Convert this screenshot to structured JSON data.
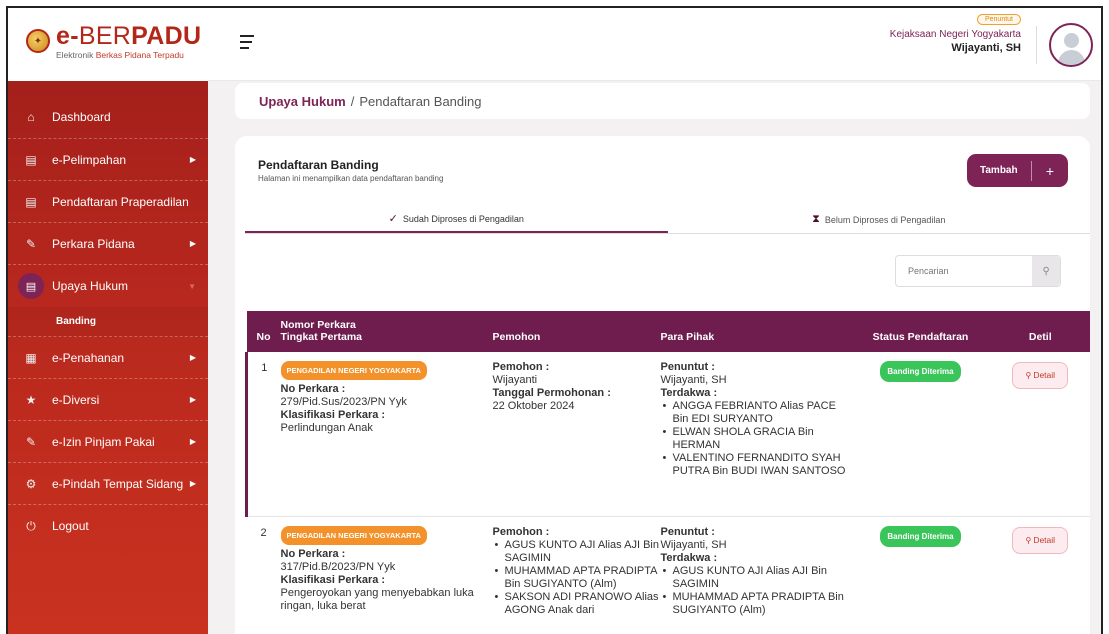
{
  "brand": {
    "title_e": "e-",
    "title_ber": "BER",
    "title_padu": "PADU",
    "sub_a": "Elektronik ",
    "sub_b": "Berkas Pidana Terpadu"
  },
  "user": {
    "role": "Penuntut",
    "org": "Kejaksaan Negeri Yogyakarta",
    "name": "Wijayanti, SH"
  },
  "sidebar": {
    "items": [
      {
        "label": "Dashboard",
        "icon": "home-icon"
      },
      {
        "label": "e-Pelimpahan",
        "icon": "document-icon"
      },
      {
        "label": "Pendaftaran Praperadilan",
        "icon": "document-icon"
      },
      {
        "label": "Perkara Pidana",
        "icon": "edit-icon"
      },
      {
        "label": "Upaya Hukum",
        "icon": "document-icon"
      },
      {
        "label": "e-Penahanan",
        "icon": "grid-icon"
      },
      {
        "label": "e-Diversi",
        "icon": "star-icon"
      },
      {
        "label": "e-Izin Pinjam Pakai",
        "icon": "edit-icon"
      },
      {
        "label": "e-Pindah Tempat Sidang",
        "icon": "gear-icon"
      },
      {
        "label": "Logout",
        "icon": "power-icon"
      }
    ],
    "sub_items": [
      {
        "label": "Banding"
      }
    ]
  },
  "breadcrumb": {
    "root": "Upaya Hukum",
    "sep": "/",
    "current": "Pendaftaran Banding"
  },
  "card": {
    "title": "Pendaftaran Banding",
    "subtitle": "Halaman ini menampilkan data pendaftaran banding",
    "add_label": "Tambah",
    "add_plus": "+"
  },
  "tabs": [
    {
      "label": "Sudah Diproses di Pengadilan",
      "icon": "check-icon"
    },
    {
      "label": "Belum Diproses di Pengadilan",
      "icon": "hourglass-icon"
    }
  ],
  "search": {
    "placeholder": "Pencarian"
  },
  "table": {
    "headers": {
      "no": "No",
      "nomor_a": "Nomor Perkara",
      "nomor_b": "Tingkat Pertama",
      "pemohon": "Pemohon",
      "pihak": "Para Pihak",
      "status": "Status Pendaftaran",
      "detil": "Detil"
    },
    "rows": [
      {
        "no": "1",
        "court": "PENGADILAN NEGERI YOGYAKARTA",
        "no_perkara_label": "No Perkara :",
        "no_perkara": "279/Pid.Sus/2023/PN Yyk",
        "klasifikasi_label": "Klasifikasi Perkara :",
        "klasifikasi": "Perlindungan Anak",
        "pemohon_label": "Pemohon :",
        "pemohon": "Wijayanti",
        "tanggal_label": "Tanggal Permohonan :",
        "tanggal": "22 Oktober 2024",
        "penuntut_label": "Penuntut :",
        "penuntut": "Wijayanti, SH",
        "terdakwa_label": "Terdakwa :",
        "terdakwa": [
          "ANGGA FEBRIANTO Alias PACE Bin EDI SURYANTO",
          "ELWAN SHOLA GRACIA Bin HERMAN",
          "VALENTINO FERNANDITO SYAH PUTRA Bin BUDI IWAN SANTOSO"
        ],
        "status": "Banding Diterima",
        "detail": "Detail"
      },
      {
        "no": "2",
        "court": "PENGADILAN NEGERI YOGYAKARTA",
        "no_perkara_label": "No Perkara :",
        "no_perkara": "317/Pid.B/2023/PN Yyk",
        "klasifikasi_label": "Klasifikasi Perkara :",
        "klasifikasi": "Pengeroyokan yang menyebabkan luka ringan, luka berat",
        "pemohon_label": "Pemohon :",
        "pemohon_list": [
          "AGUS KUNTO AJI Alias AJI Bin SAGIMIN",
          "MUHAMMAD APTA PRADIPTA Bin SUGIYANTO (Alm)",
          "SAKSON ADI PRANOWO Alias AGONG Anak dari"
        ],
        "penuntut_label": "Penuntut :",
        "penuntut": "Wijayanti, SH",
        "terdakwa_label": "Terdakwa :",
        "terdakwa": [
          "AGUS KUNTO AJI Alias AJI Bin SAGIMIN",
          "MUHAMMAD APTA PRADIPTA Bin SUGIYANTO (Alm)"
        ],
        "status": "Banding Diterima",
        "detail": "Detail"
      }
    ]
  }
}
